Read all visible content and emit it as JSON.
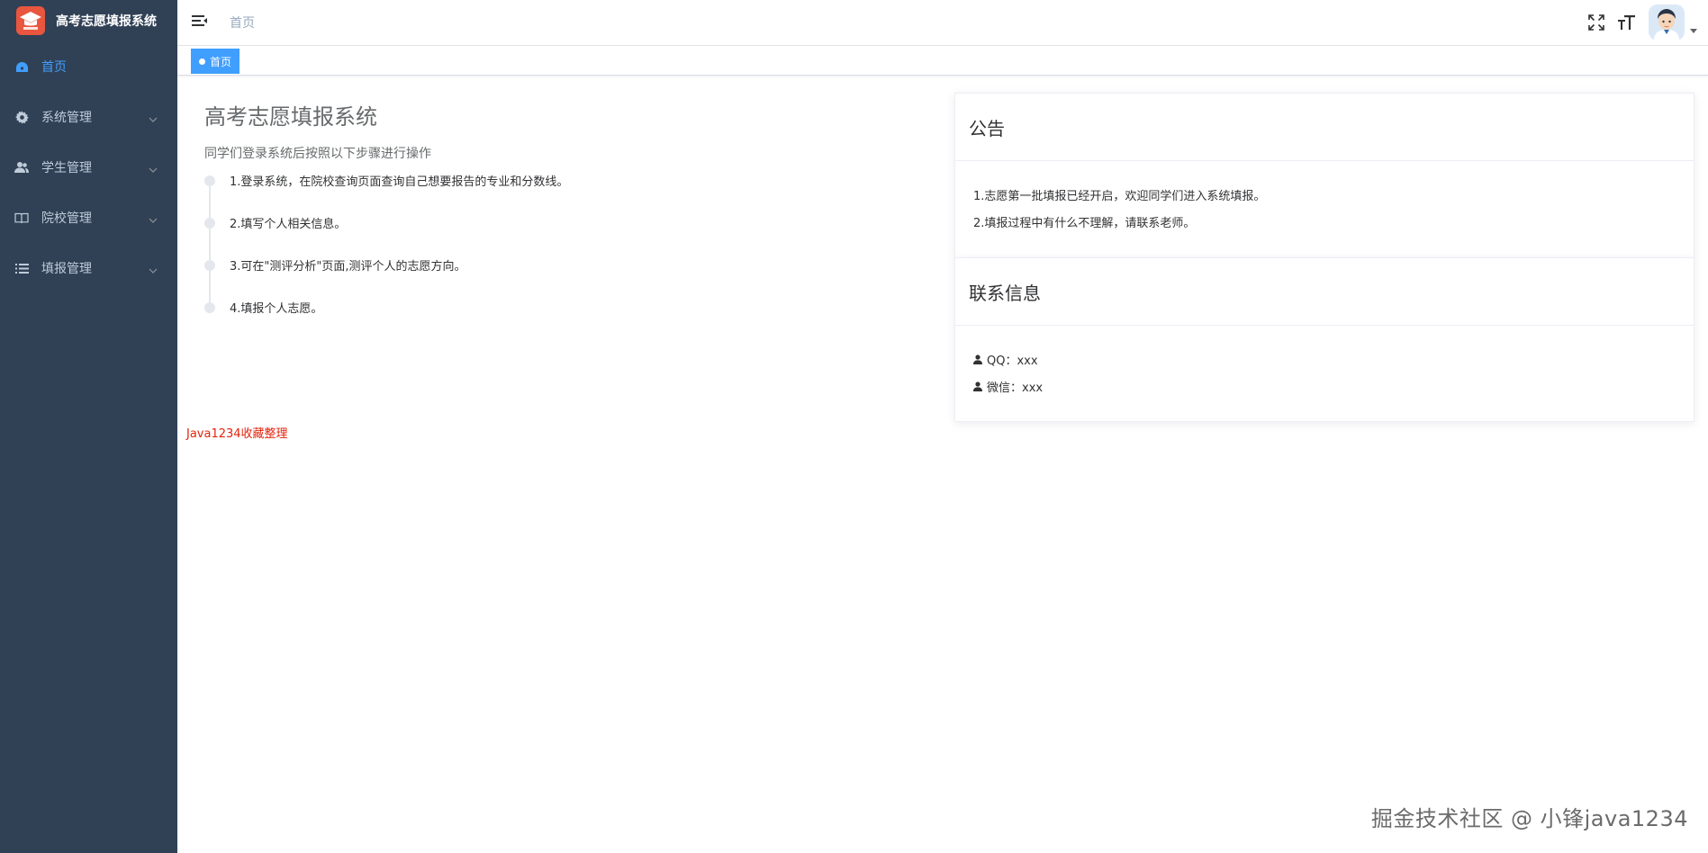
{
  "app": {
    "title": "高考志愿填报系统",
    "logo_text": "高考志愿"
  },
  "sidebar": {
    "items": [
      {
        "label": "首页",
        "icon": "dashboard-icon",
        "active": true
      },
      {
        "label": "系统管理",
        "icon": "gear-icon"
      },
      {
        "label": "学生管理",
        "icon": "users-icon"
      },
      {
        "label": "院校管理",
        "icon": "book-icon"
      },
      {
        "label": "填报管理",
        "icon": "list-icon"
      }
    ]
  },
  "navbar": {
    "breadcrumb": "首页"
  },
  "tags": {
    "active": "首页"
  },
  "main": {
    "title": "高考志愿填报系统",
    "subtitle": "同学们登录系统后按照以下步骤进行操作",
    "steps": [
      "1.登录系统，在院校查询页面查询自己想要报告的专业和分数线。",
      "2.填写个人相关信息。",
      "3.可在\"测评分析\"页面,测评个人的志愿方向。",
      "4.填报个人志愿。"
    ],
    "red_note": "Java1234收藏整理"
  },
  "notice": {
    "title": "公告",
    "items": [
      "1.志愿第一批填报已经开启，欢迎同学们进入系统填报。",
      "2.填报过程中有什么不理解，请联系老师。"
    ]
  },
  "contact": {
    "title": "联系信息",
    "items": [
      {
        "icon": "user-icon",
        "text": "QQ：xxx"
      },
      {
        "icon": "user-icon",
        "text": "微信：xxx"
      }
    ]
  },
  "footer": {
    "watermark": "掘金技术社区 @ 小锋java1234"
  },
  "colors": {
    "sidebar_bg": "#304156",
    "accent": "#409eff",
    "red": "#e3230c"
  }
}
